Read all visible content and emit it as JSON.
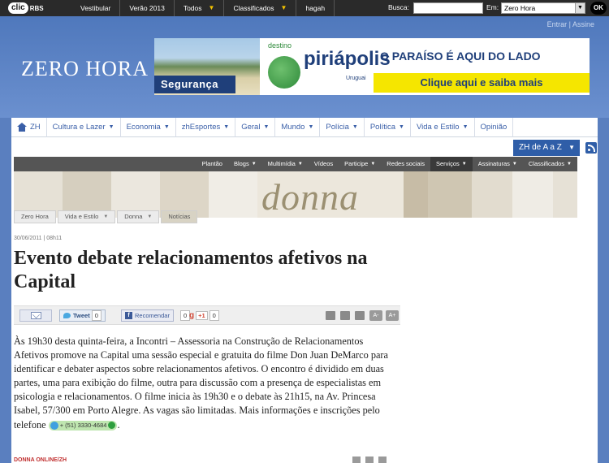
{
  "topbar": {
    "logo_clic": "clic",
    "logo_rbs": "RBS",
    "nav": [
      "Vestibular",
      "Verão 2013",
      "Todos",
      "Classificados",
      "hagah"
    ],
    "search_label": "Busca:",
    "scope_label": "Em:",
    "scope_value": "Zero Hora",
    "ok_label": "OK"
  },
  "header": {
    "account_links": "Entrar | Assine",
    "logo": "ZERO HORA",
    "banner": {
      "seguranca": "Segurança",
      "destino": "destino",
      "piriapolis": "piriápolis",
      "uruguai": "Uruguai",
      "paraiso": "O PARAÍSO É AQUI DO LADO",
      "clique": "Clique aqui e saiba mais"
    }
  },
  "main_nav": {
    "home": "ZH",
    "items": [
      "Cultura e Lazer",
      "Economia",
      "zhEsportes",
      "Geral",
      "Mundo",
      "Polícia",
      "Política",
      "Vida e Estilo",
      "Opinião"
    ]
  },
  "zhaz": "ZH de A a Z",
  "section_nav": [
    "Plantão",
    "Blogs",
    "Multimídia",
    "Vídeos",
    "Participe",
    "Redes sociais",
    "Serviços",
    "Assinaturas",
    "Classificados"
  ],
  "section_title": "donna",
  "breadcrumb": [
    "Zero Hora",
    "Vida e Estilo",
    "Donna",
    "Notícias"
  ],
  "article": {
    "datetime": "30/06/2011 | 08h11",
    "title": "Evento debate relacionamentos afetivos na Capital",
    "body": "Às 19h30 desta quinta-feira, a Incontri – Assessoria na Construção de Relacionamentos Afetivos promove na Capital uma sessão especial e gratuita do filme Don Juan DeMarco para identificar e debater aspectos sobre relacionamentos afetivos. O encontro é dividido em duas partes, uma para exibição do filme, outra para discussão com a presença de especialistas em psicologia e relacionamentos. O filme inicia às 19h30 e o debate às 21h15, na Av. Princesa Isabel, 57/300 em Porto Alegre. As vagas são limitadas. Mais informações e inscrições pelo telefone",
    "phone": "+ (51) 3330-4684",
    "end_punct": ".",
    "source": "DONNA ONLINE/ZH"
  },
  "share": {
    "tweet": "Tweet",
    "tweet_count": "0",
    "recommend": "Recomendar",
    "recommend_count": "0",
    "gplus": "+1",
    "gplus_count": "0",
    "font_decrease": "A-",
    "font_increase": "A+"
  }
}
